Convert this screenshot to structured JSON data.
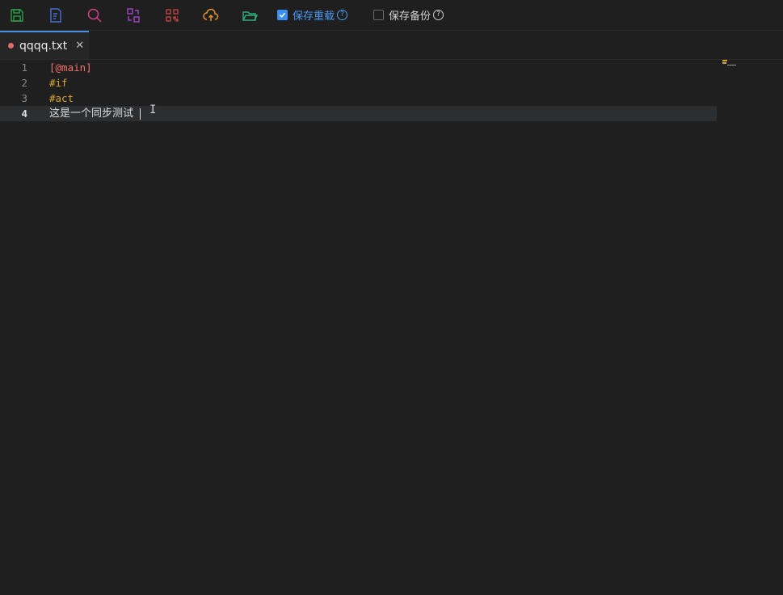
{
  "toolbar": {
    "icons": [
      {
        "name": "save-icon",
        "color": "#2e9e48"
      },
      {
        "name": "edit-document-icon",
        "color": "#4a6fd1"
      },
      {
        "name": "search-icon",
        "color": "#d13f8a"
      },
      {
        "name": "replace-icon",
        "color": "#a347c9"
      },
      {
        "name": "qrcode-icon",
        "color": "#c94545"
      },
      {
        "name": "cloud-upload-icon",
        "color": "#e3922c"
      },
      {
        "name": "folder-open-icon",
        "color": "#2eae7f"
      }
    ],
    "save_reload": {
      "label": "保存重载",
      "checked": true,
      "help": "?"
    },
    "save_backup": {
      "label": "保存备份",
      "checked": false,
      "help": "?"
    }
  },
  "tabs": [
    {
      "label": "qqqq.txt",
      "modified": true,
      "close": "✕"
    }
  ],
  "editor": {
    "lines": [
      {
        "number": "1",
        "text": "[@main]"
      },
      {
        "number": "2",
        "text": "#if"
      },
      {
        "number": "3",
        "text": "#act"
      },
      {
        "number": "4",
        "text": "这是一个同步测试"
      }
    ],
    "active_line": 4,
    "colors": {
      "label": "#f47067",
      "keyword": "#d7a62a",
      "text": "#dcdcdc",
      "active_line_bg": "#2b2f31"
    }
  }
}
